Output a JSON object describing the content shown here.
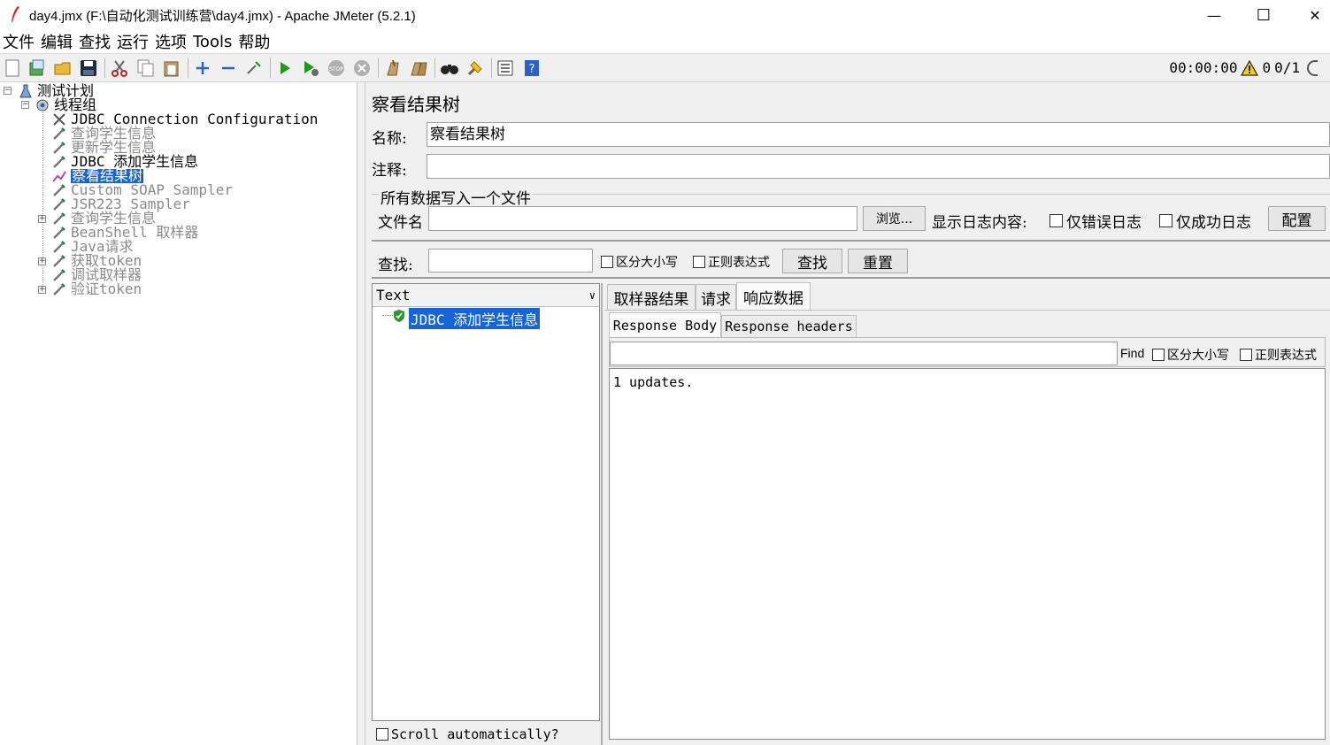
{
  "window": {
    "title": "day4.jmx (F:\\自动化测试训练营\\day4.jmx) - Apache JMeter (5.2.1)",
    "minimize_glyph": "—",
    "maximize_glyph": "☐",
    "close_glyph": "✕"
  },
  "menu": [
    "文件",
    "编辑",
    "查找",
    "运行",
    "选项",
    "Tools",
    "帮助"
  ],
  "toolbar": {
    "icons": [
      "new-icon",
      "templates-icon",
      "open-icon",
      "save-icon",
      "cut-icon",
      "copy-icon",
      "paste-icon",
      "expand-icon",
      "collapse-icon",
      "toggle-icon",
      "start-icon",
      "start-no-pause-icon",
      "stop-icon",
      "shutdown-icon",
      "clear-icon",
      "clear-all-icon",
      "search-icon",
      "reset-search-icon",
      "function-helper-icon",
      "help-icon"
    ],
    "timer": "00:00:00",
    "warning_count": "0",
    "threads": "0/1"
  },
  "tree": {
    "test_plan": "测试计划",
    "thread_group": "线程组",
    "items": [
      {
        "label": "JDBC Connection Configuration",
        "enabled": true,
        "selected": false,
        "expandable": false,
        "icon": "wrench-icon"
      },
      {
        "label": "查询学生信息",
        "enabled": false,
        "selected": false,
        "expandable": false,
        "icon": "pipette-icon"
      },
      {
        "label": "更新学生信息",
        "enabled": false,
        "selected": false,
        "expandable": false,
        "icon": "pipette-icon"
      },
      {
        "label": "JDBC 添加学生信息",
        "enabled": true,
        "selected": false,
        "expandable": false,
        "icon": "pipette-icon"
      },
      {
        "label": "察看结果树",
        "enabled": true,
        "selected": true,
        "expandable": false,
        "icon": "chart-icon"
      },
      {
        "label": "Custom SOAP Sampler",
        "enabled": false,
        "selected": false,
        "expandable": false,
        "icon": "pipette-icon"
      },
      {
        "label": "JSR223 Sampler",
        "enabled": false,
        "selected": false,
        "expandable": false,
        "icon": "pipette-icon"
      },
      {
        "label": "查询学生信息",
        "enabled": false,
        "selected": false,
        "expandable": true,
        "icon": "pipette-icon"
      },
      {
        "label": "BeanShell 取样器",
        "enabled": false,
        "selected": false,
        "expandable": false,
        "icon": "pipette-icon"
      },
      {
        "label": "Java请求",
        "enabled": false,
        "selected": false,
        "expandable": false,
        "icon": "pipette-icon"
      },
      {
        "label": "获取token",
        "enabled": false,
        "selected": false,
        "expandable": true,
        "icon": "pipette-icon"
      },
      {
        "label": "调试取样器",
        "enabled": false,
        "selected": false,
        "expandable": false,
        "icon": "pipette-icon"
      },
      {
        "label": "验证token",
        "enabled": false,
        "selected": false,
        "expandable": true,
        "icon": "pipette-icon"
      }
    ]
  },
  "panel": {
    "title": "察看结果树",
    "name_label": "名称:",
    "name_value": "察看结果树",
    "comment_label": "注释:",
    "comment_value": "",
    "file_section_title": "所有数据写入一个文件",
    "filename_label": "文件名",
    "filename_value": "",
    "browse_button": "浏览...",
    "log_label": "显示日志内容:",
    "errors_only": "仅错误日志",
    "success_only": "仅成功日志",
    "configure_button": "配置",
    "search_label": "查找:",
    "search_value": "",
    "case_sensitive": "区分大小写",
    "regex": "正则表达式",
    "find_button": "查找",
    "reset_button": "重置",
    "renderer": "Text",
    "result_item": "JDBC 添加学生信息",
    "scroll_auto": "Scroll automatically?",
    "tabs": [
      "取样器结果",
      "请求",
      "响应数据"
    ],
    "active_tab": "响应数据",
    "subtabs": [
      "Response Body",
      "Response headers"
    ],
    "find_label": "Find",
    "find_case": "区分大小写",
    "find_regex": "正则表达式",
    "response_text": "1 updates."
  }
}
